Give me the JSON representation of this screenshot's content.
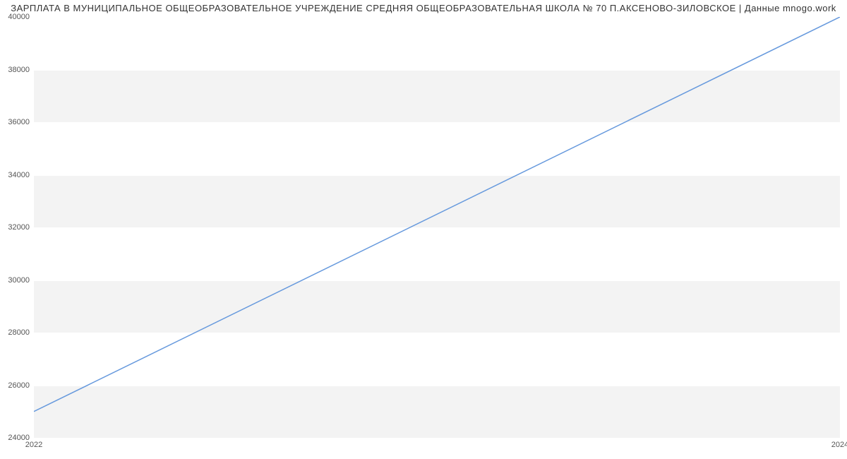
{
  "chart_data": {
    "type": "line",
    "title": "ЗАРПЛАТА В МУНИЦИПАЛЬНОЕ ОБЩЕОБРАЗОВАТЕЛЬНОЕ УЧРЕЖДЕНИЕ СРЕДНЯЯ ОБЩЕОБРАЗОВАТЕЛЬНАЯ ШКОЛА № 70 П.АКСЕНОВО-ЗИЛОВСКОЕ | Данные mnogo.work",
    "x": [
      2022,
      2024
    ],
    "values": [
      25000,
      40000
    ],
    "xlabel": "",
    "ylabel": "",
    "xlim": [
      2022,
      2024
    ],
    "ylim": [
      24000,
      40000
    ],
    "x_ticks": [
      2022,
      2024
    ],
    "x_tick_labels": [
      "2022",
      "2024"
    ],
    "y_ticks": [
      24000,
      26000,
      28000,
      30000,
      32000,
      34000,
      36000,
      38000,
      40000
    ],
    "y_tick_labels": [
      "24000",
      "26000",
      "28000",
      "30000",
      "32000",
      "34000",
      "36000",
      "38000",
      "40000"
    ],
    "line_color": "#6699dd"
  }
}
